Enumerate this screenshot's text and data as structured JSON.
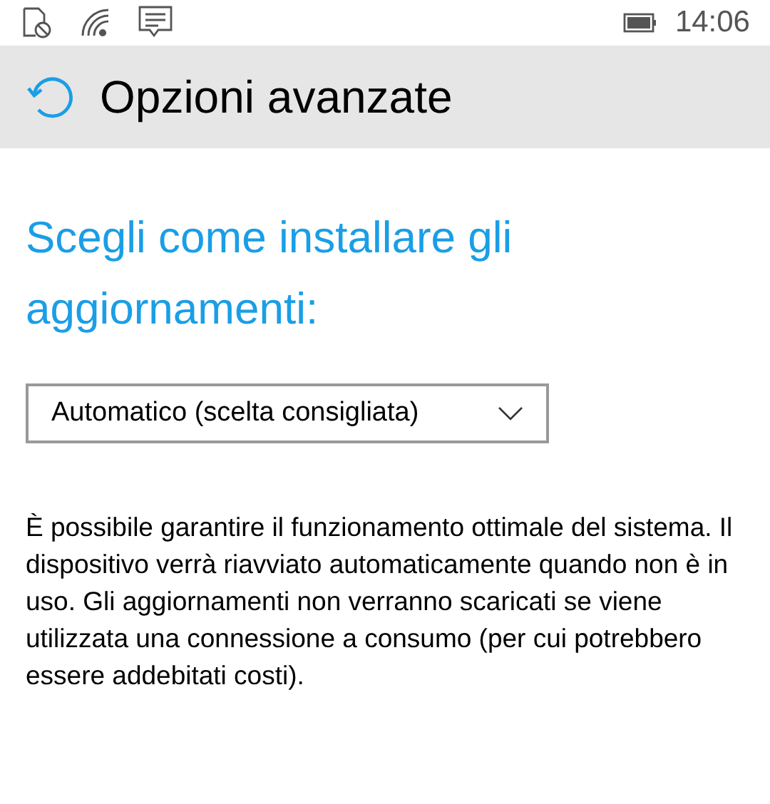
{
  "status_bar": {
    "time": "14:06"
  },
  "header": {
    "title": "Opzioni avanzate"
  },
  "section": {
    "heading": "Scegli come installare gli aggiornamenti:"
  },
  "dropdown": {
    "value": "Automatico (scelta consigliata)"
  },
  "description": "È possibile garantire il funzionamento ottimale del sistema. Il dispositivo verrà riavviato automaticamente quando non è in uso. Gli aggiornamenti non verranno scaricati se viene utilizzata una connessione a consumo (per cui potrebbero essere addebitati costi)."
}
